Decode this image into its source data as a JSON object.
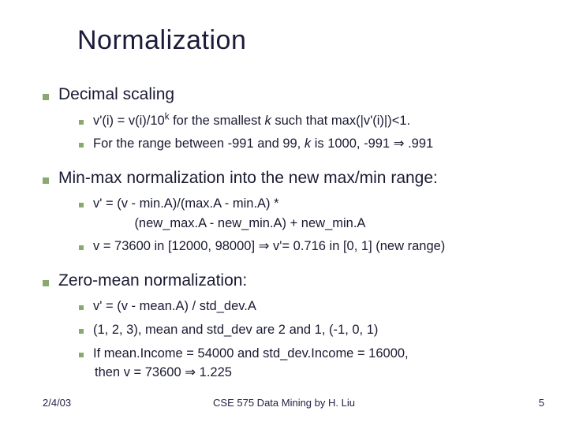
{
  "title": "Normalization",
  "sec1": {
    "heading": "Decimal scaling"
  },
  "s1b1a": "v'(i) = v(i)/10",
  "s1b1b": " for the smallest ",
  "s1b1c": " such that max(|v'(i)|)<1.",
  "s1b2a": "For the range between -991 and 99, ",
  "s1b2b": " is 1000, -991 ",
  "s1b2c": " .991",
  "sec2": {
    "heading": "Min-max normalization into the new max/min range:"
  },
  "s2b1": "v' = (v - min.A)/(max.A - min.A) *",
  "s2b1cont": "(new_max.A - new_min.A) + new_min.A",
  "s2b2a": "v = 73600 in [12000, 98000] ",
  "s2b2b": " v'= 0.716 in [0, 1] (new range)",
  "sec3": {
    "heading": "Zero-mean normalization:"
  },
  "s3b1": "v' = (v - mean.A) / std_dev.A",
  "s3b2": "(1, 2, 3), mean and std_dev are 2 and 1, (-1, 0, 1)",
  "s3b3a": "If mean.Income = 54000 and std_dev.Income = 16000,",
  "s3b3b": "then v = 73600 ",
  "s3b3c": " 1.225",
  "k": "k",
  "sup_k": "k",
  "arrow": "⇒",
  "footer": {
    "date": "2/4/03",
    "center": "CSE 575 Data Mining by H. Liu",
    "page": "5"
  }
}
